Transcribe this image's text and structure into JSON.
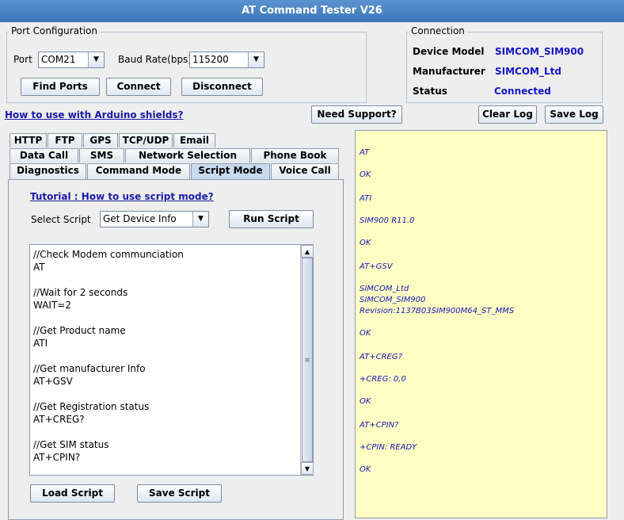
{
  "window": {
    "title": "AT Command Tester V26"
  },
  "port_config": {
    "title": "Port Configuration",
    "port_label": "Port",
    "port_value": "COM21",
    "baud_label": "Baud Rate(bps)",
    "baud_value": "115200",
    "find_ports": "Find Ports",
    "connect": "Connect",
    "disconnect": "Disconnect"
  },
  "connection": {
    "title": "Connection",
    "device_model_label": "Device Model",
    "device_model_value": "SIMCOM_SIM900",
    "manufacturer_label": "Manufacturer",
    "manufacturer_value": "SIMCOM_Ltd",
    "status_label": "Status",
    "status_value": "Connected"
  },
  "links": {
    "arduino": "How to use with Arduino shields?"
  },
  "buttons": {
    "need_support": "Need Support?",
    "clear_log": "Clear Log",
    "save_log": "Save Log"
  },
  "tabs": {
    "row1": [
      "HTTP",
      "FTP",
      "GPS",
      "TCP/UDP",
      "Email"
    ],
    "row2": [
      "Data Call",
      "SMS",
      "Network Selection",
      "Phone Book"
    ],
    "row3": [
      "Diagnostics",
      "Command Mode",
      "Script Mode",
      "Voice Call"
    ],
    "selected": "Script Mode"
  },
  "script_mode": {
    "tutorial_link": "Tutorial : How to use script mode?",
    "select_label": "Select Script",
    "select_value": "Get Device Info",
    "run_script": "Run Script",
    "script_lines": "//Check Modem communciation\nAT\n\n//Wait for 2 seconds\nWAIT=2\n\n//Get Product name\nATI\n\n//Get manufacturer Info\nAT+GSV\n\n//Get Registration status\nAT+CREG?\n\n//Get SIM status\nAT+CPIN?",
    "load_script": "Load Script",
    "save_script": "Save Script"
  },
  "log": {
    "lines": [
      "AT",
      "OK",
      "ATI",
      "SIM900 R11.0",
      "OK",
      "AT+GSV",
      "SIMCOM_Ltd",
      "SIMCOM_SIM900",
      "Revision:1137B03SIM900M64_ST_MMS",
      "OK",
      "AT+CREG?",
      "+CREG: 0,0",
      "OK",
      "AT+CPIN?",
      "+CPIN: READY",
      "OK"
    ]
  },
  "icons": {
    "dropdown": "chevron-down-icon",
    "scroll_up": "arrow-up-icon",
    "scroll_down": "arrow-down-icon"
  }
}
